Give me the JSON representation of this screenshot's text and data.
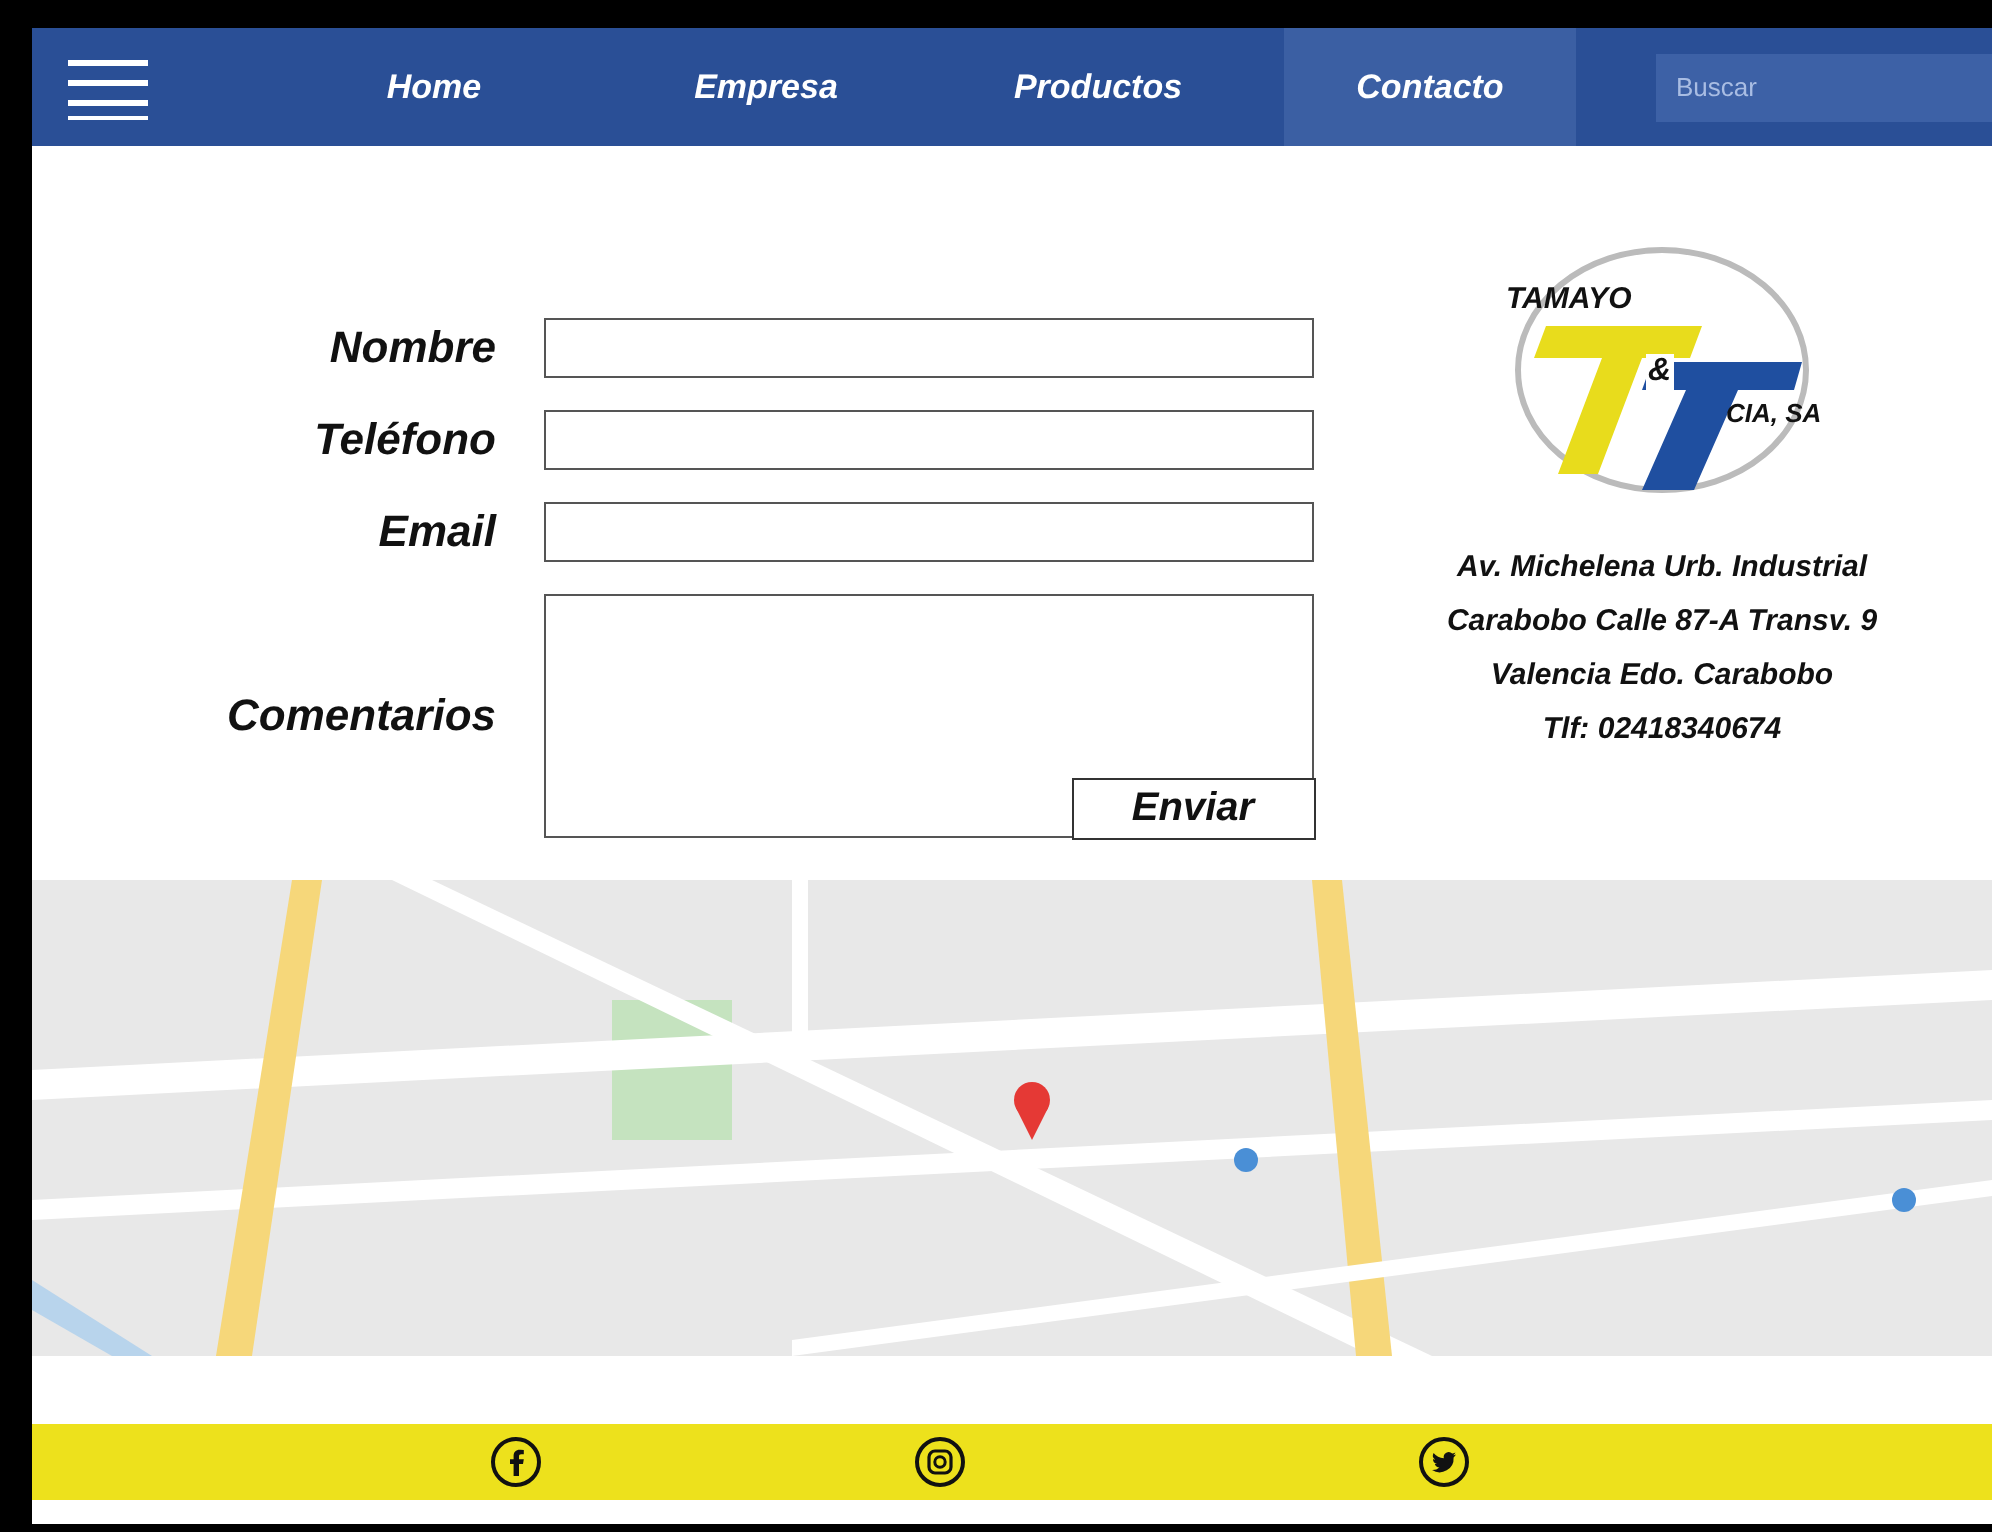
{
  "nav": {
    "items": [
      {
        "label": "Home",
        "selected": false
      },
      {
        "label": "Empresa",
        "selected": false
      },
      {
        "label": "Productos",
        "selected": false
      },
      {
        "label": "Contacto",
        "selected": true
      }
    ],
    "search": {
      "placeholder": "Buscar"
    }
  },
  "form": {
    "fields": [
      {
        "label": "Nombre",
        "kind": "input"
      },
      {
        "label": "Teléfono",
        "kind": "input"
      },
      {
        "label": "Email",
        "kind": "input"
      },
      {
        "label": "Comentarios",
        "kind": "textarea"
      }
    ],
    "submit": "Enviar"
  },
  "logo": {
    "top": "TAMAYO",
    "amp": "&",
    "side": "CIA, SA"
  },
  "address": [
    "Av. Michelena Urb. Industrial",
    "Carabobo Calle 87-A Transv. 9",
    "Valencia Edo. Carabobo",
    "Tlf: 02418340674"
  ],
  "footer": {
    "social": [
      {
        "kind": "facebook"
      },
      {
        "kind": "instagram"
      },
      {
        "kind": "twitter"
      }
    ]
  }
}
